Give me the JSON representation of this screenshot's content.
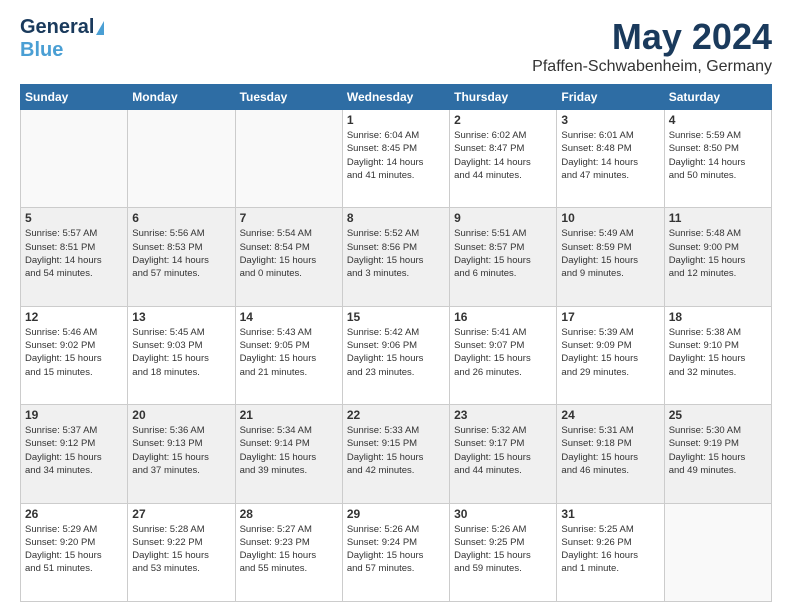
{
  "header": {
    "logo_line1": "General",
    "logo_line2": "Blue",
    "month": "May 2024",
    "location": "Pfaffen-Schwabenheim, Germany"
  },
  "weekdays": [
    "Sunday",
    "Monday",
    "Tuesday",
    "Wednesday",
    "Thursday",
    "Friday",
    "Saturday"
  ],
  "weeks": [
    [
      {
        "day": "",
        "info": ""
      },
      {
        "day": "",
        "info": ""
      },
      {
        "day": "",
        "info": ""
      },
      {
        "day": "1",
        "info": "Sunrise: 6:04 AM\nSunset: 8:45 PM\nDaylight: 14 hours\nand 41 minutes."
      },
      {
        "day": "2",
        "info": "Sunrise: 6:02 AM\nSunset: 8:47 PM\nDaylight: 14 hours\nand 44 minutes."
      },
      {
        "day": "3",
        "info": "Sunrise: 6:01 AM\nSunset: 8:48 PM\nDaylight: 14 hours\nand 47 minutes."
      },
      {
        "day": "4",
        "info": "Sunrise: 5:59 AM\nSunset: 8:50 PM\nDaylight: 14 hours\nand 50 minutes."
      }
    ],
    [
      {
        "day": "5",
        "info": "Sunrise: 5:57 AM\nSunset: 8:51 PM\nDaylight: 14 hours\nand 54 minutes."
      },
      {
        "day": "6",
        "info": "Sunrise: 5:56 AM\nSunset: 8:53 PM\nDaylight: 14 hours\nand 57 minutes."
      },
      {
        "day": "7",
        "info": "Sunrise: 5:54 AM\nSunset: 8:54 PM\nDaylight: 15 hours\nand 0 minutes."
      },
      {
        "day": "8",
        "info": "Sunrise: 5:52 AM\nSunset: 8:56 PM\nDaylight: 15 hours\nand 3 minutes."
      },
      {
        "day": "9",
        "info": "Sunrise: 5:51 AM\nSunset: 8:57 PM\nDaylight: 15 hours\nand 6 minutes."
      },
      {
        "day": "10",
        "info": "Sunrise: 5:49 AM\nSunset: 8:59 PM\nDaylight: 15 hours\nand 9 minutes."
      },
      {
        "day": "11",
        "info": "Sunrise: 5:48 AM\nSunset: 9:00 PM\nDaylight: 15 hours\nand 12 minutes."
      }
    ],
    [
      {
        "day": "12",
        "info": "Sunrise: 5:46 AM\nSunset: 9:02 PM\nDaylight: 15 hours\nand 15 minutes."
      },
      {
        "day": "13",
        "info": "Sunrise: 5:45 AM\nSunset: 9:03 PM\nDaylight: 15 hours\nand 18 minutes."
      },
      {
        "day": "14",
        "info": "Sunrise: 5:43 AM\nSunset: 9:05 PM\nDaylight: 15 hours\nand 21 minutes."
      },
      {
        "day": "15",
        "info": "Sunrise: 5:42 AM\nSunset: 9:06 PM\nDaylight: 15 hours\nand 23 minutes."
      },
      {
        "day": "16",
        "info": "Sunrise: 5:41 AM\nSunset: 9:07 PM\nDaylight: 15 hours\nand 26 minutes."
      },
      {
        "day": "17",
        "info": "Sunrise: 5:39 AM\nSunset: 9:09 PM\nDaylight: 15 hours\nand 29 minutes."
      },
      {
        "day": "18",
        "info": "Sunrise: 5:38 AM\nSunset: 9:10 PM\nDaylight: 15 hours\nand 32 minutes."
      }
    ],
    [
      {
        "day": "19",
        "info": "Sunrise: 5:37 AM\nSunset: 9:12 PM\nDaylight: 15 hours\nand 34 minutes."
      },
      {
        "day": "20",
        "info": "Sunrise: 5:36 AM\nSunset: 9:13 PM\nDaylight: 15 hours\nand 37 minutes."
      },
      {
        "day": "21",
        "info": "Sunrise: 5:34 AM\nSunset: 9:14 PM\nDaylight: 15 hours\nand 39 minutes."
      },
      {
        "day": "22",
        "info": "Sunrise: 5:33 AM\nSunset: 9:15 PM\nDaylight: 15 hours\nand 42 minutes."
      },
      {
        "day": "23",
        "info": "Sunrise: 5:32 AM\nSunset: 9:17 PM\nDaylight: 15 hours\nand 44 minutes."
      },
      {
        "day": "24",
        "info": "Sunrise: 5:31 AM\nSunset: 9:18 PM\nDaylight: 15 hours\nand 46 minutes."
      },
      {
        "day": "25",
        "info": "Sunrise: 5:30 AM\nSunset: 9:19 PM\nDaylight: 15 hours\nand 49 minutes."
      }
    ],
    [
      {
        "day": "26",
        "info": "Sunrise: 5:29 AM\nSunset: 9:20 PM\nDaylight: 15 hours\nand 51 minutes."
      },
      {
        "day": "27",
        "info": "Sunrise: 5:28 AM\nSunset: 9:22 PM\nDaylight: 15 hours\nand 53 minutes."
      },
      {
        "day": "28",
        "info": "Sunrise: 5:27 AM\nSunset: 9:23 PM\nDaylight: 15 hours\nand 55 minutes."
      },
      {
        "day": "29",
        "info": "Sunrise: 5:26 AM\nSunset: 9:24 PM\nDaylight: 15 hours\nand 57 minutes."
      },
      {
        "day": "30",
        "info": "Sunrise: 5:26 AM\nSunset: 9:25 PM\nDaylight: 15 hours\nand 59 minutes."
      },
      {
        "day": "31",
        "info": "Sunrise: 5:25 AM\nSunset: 9:26 PM\nDaylight: 16 hours\nand 1 minute."
      },
      {
        "day": "",
        "info": ""
      }
    ]
  ]
}
